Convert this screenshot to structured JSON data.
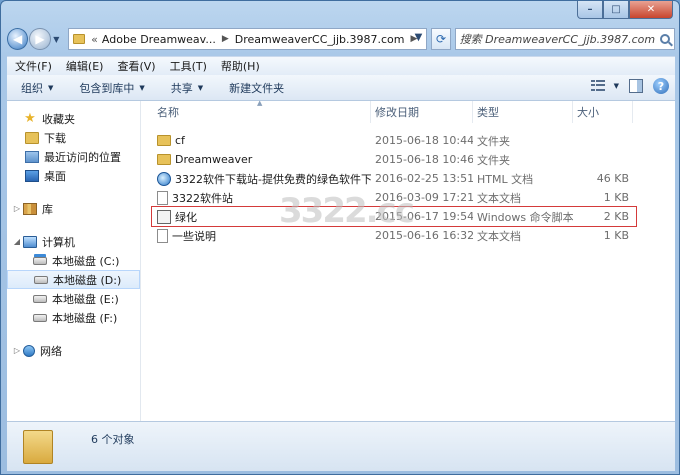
{
  "window": {
    "caption_buttons": {
      "min": "–",
      "max": "□",
      "close": "✕"
    }
  },
  "address": {
    "overflow": "«",
    "crumbs": [
      "Adobe Dreamweav...",
      "DreamweaverCC_jjb.3987.com"
    ],
    "search_placeholder": "搜索 DreamweaverCC_jjb.3987.com"
  },
  "menu": [
    "文件(F)",
    "编辑(E)",
    "查看(V)",
    "工具(T)",
    "帮助(H)"
  ],
  "toolbar": {
    "organize": "组织",
    "include": "包含到库中",
    "share": "共享",
    "new_folder": "新建文件夹"
  },
  "sidebar": {
    "favorites": {
      "label": "收藏夹",
      "items": [
        "下载",
        "最近访问的位置",
        "桌面"
      ]
    },
    "libraries": {
      "label": "库"
    },
    "computer": {
      "label": "计算机",
      "items": [
        "本地磁盘 (C:)",
        "本地磁盘 (D:)",
        "本地磁盘 (E:)",
        "本地磁盘 (F:)"
      ],
      "selected_index": 1
    },
    "network": {
      "label": "网络"
    }
  },
  "columns": {
    "name": "名称",
    "date": "修改日期",
    "type": "类型",
    "size": "大小"
  },
  "files": [
    {
      "name": "cf",
      "date": "2015-06-18 10:44",
      "type": "文件夹",
      "size": "",
      "icon": "folder-icon"
    },
    {
      "name": "Dreamweaver",
      "date": "2015-06-18 10:46",
      "type": "文件夹",
      "size": "",
      "icon": "folder-icon"
    },
    {
      "name": "3322软件下载站-提供免费的绿色软件下...",
      "date": "2016-02-25 13:51",
      "type": "HTML 文档",
      "size": "46 KB",
      "icon": "html-file-icon"
    },
    {
      "name": "3322软件站",
      "date": "2016-03-09 17:21",
      "type": "文本文档",
      "size": "1 KB",
      "icon": "text-file-icon"
    },
    {
      "name": "绿化",
      "date": "2015-06-17 19:54",
      "type": "Windows 命令脚本",
      "size": "2 KB",
      "icon": "cmd-script-icon",
      "highlighted": true
    },
    {
      "name": "一些说明",
      "date": "2015-06-16 16:32",
      "type": "文本文档",
      "size": "1 KB",
      "icon": "text-file-icon"
    }
  ],
  "watermark": "3322.cc",
  "status": {
    "count": "6 个对象"
  },
  "colors": {
    "highlight": "#d43a3a",
    "frame": "#a9c8e8"
  }
}
